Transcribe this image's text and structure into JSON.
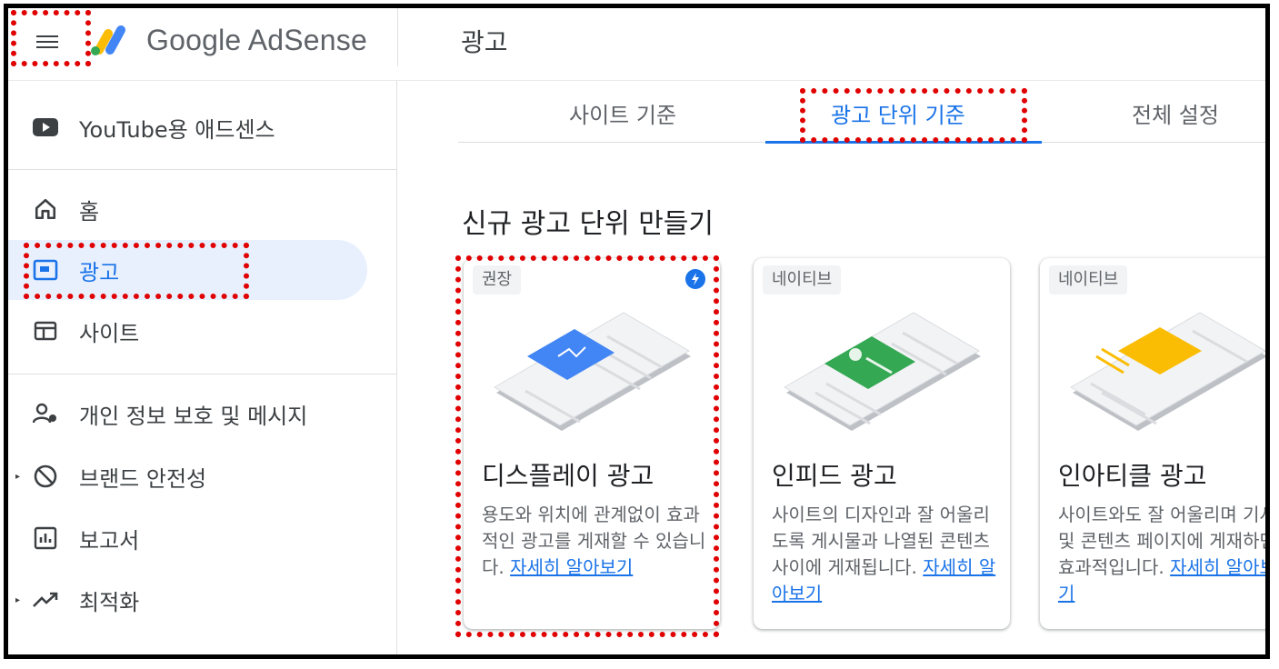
{
  "header": {
    "brand": "Google AdSense",
    "page_title": "광고"
  },
  "sidebar": {
    "items": [
      {
        "label": "YouTube용 애드센스",
        "icon": "youtube-icon"
      },
      {
        "label": "홈",
        "icon": "home-icon"
      },
      {
        "label": "광고",
        "icon": "ads-icon",
        "active": true
      },
      {
        "label": "사이트",
        "icon": "sites-icon"
      },
      {
        "label": "개인 정보 보호 및 메시지",
        "icon": "privacy-icon"
      },
      {
        "label": "브랜드 안전성",
        "icon": "block-icon"
      },
      {
        "label": "보고서",
        "icon": "report-icon"
      },
      {
        "label": "최적화",
        "icon": "trending-icon"
      }
    ]
  },
  "tabs": [
    {
      "label": "사이트 기준"
    },
    {
      "label": "광고 단위 기준",
      "active": true
    },
    {
      "label": "전체 설정"
    }
  ],
  "main": {
    "section_title": "신규 광고 단위 만들기",
    "cards": [
      {
        "badge": "권장",
        "title": "디스플레이 광고",
        "desc": "용도와 위치에 관계없이 효과적인 광고를 게재할 수 있습니다.",
        "link": "자세히 알아보기",
        "accent": "#4285f4"
      },
      {
        "badge": "네이티브",
        "title": "인피드 광고",
        "desc": "사이트의 디자인과 잘 어울리도록 게시물과 나열된 콘텐츠 사이에 게재됩니다.",
        "link": "자세히 알아보기",
        "accent": "#34a853"
      },
      {
        "badge": "네이티브",
        "title": "인아티클 광고",
        "desc": "사이트와도 잘 어울리며 기사 및 콘텐츠 페이지에 게재하면 효과적입니다.",
        "link": "자세히 알아보기",
        "accent": "#fbbc04"
      }
    ]
  },
  "colors": {
    "accent": "#1a73e8",
    "highlight": "#e00000",
    "active_bg": "#e8f0fe"
  }
}
